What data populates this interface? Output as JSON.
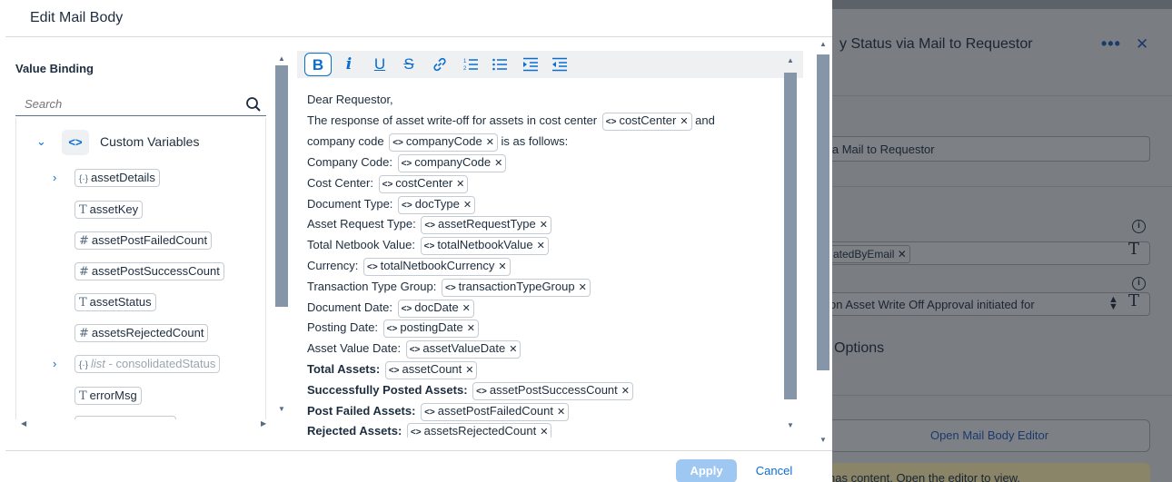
{
  "dialog": {
    "title": "Edit Mail Body",
    "apply_label": "Apply",
    "cancel_label": "Cancel"
  },
  "value_binding": {
    "title": "Value Binding",
    "search_placeholder": "Search",
    "root": "Custom Variables",
    "items": [
      {
        "name": "assetDetails",
        "type": "object"
      },
      {
        "name": "assetKey",
        "type": "T"
      },
      {
        "name": "assetPostFailedCount",
        "type": "#"
      },
      {
        "name": "assetPostSuccessCount",
        "type": "#"
      },
      {
        "name": "assetStatus",
        "type": "T"
      },
      {
        "name": "assetsRejectedCount",
        "type": "#"
      },
      {
        "name": "consolidatedStatus",
        "type": "list",
        "prefix": "list",
        "sep": " - "
      },
      {
        "name": "errorMsg",
        "type": "T"
      }
    ]
  },
  "toolbar": {
    "bold": "B",
    "italic": "i",
    "underline": "U",
    "strike": "S",
    "link": "link-icon",
    "ordered_list": "ordered-list-icon",
    "bullet_list": "bullet-list-icon",
    "indent": "indent-icon",
    "outdent": "outdent-icon"
  },
  "editor": {
    "line0": "Dear Requestor,",
    "line1_text": "The response of asset write-off for assets in cost center",
    "line1_token": "costCenter",
    "line1_tail": "and",
    "line2_text": "company code",
    "line2_token": "companyCode",
    "line2_tail": "is as follows:",
    "fields": [
      {
        "label": "Company Code:",
        "token": "companyCode",
        "bold": false
      },
      {
        "label": "Cost Center:",
        "token": "costCenter",
        "bold": false
      },
      {
        "label": "Document Type:",
        "token": "docType",
        "bold": false
      },
      {
        "label": "Asset Request Type:",
        "token": "assetRequestType",
        "bold": false
      },
      {
        "label": "Total Netbook Value:",
        "token": "totalNetbookValue",
        "bold": false
      },
      {
        "label": "Currency:",
        "token": "totalNetbookCurrency",
        "bold": false
      },
      {
        "label": "Transaction Type Group:",
        "token": "transactionTypeGroup",
        "bold": false
      },
      {
        "label": "Document Date:",
        "token": "docDate",
        "bold": false
      },
      {
        "label": "Posting Date:",
        "token": "postingDate",
        "bold": false
      },
      {
        "label": "Asset Value Date:",
        "token": "assetValueDate",
        "bold": false
      },
      {
        "label": "Total Assets:",
        "token": "assetCount",
        "bold": true
      },
      {
        "label": "Successfully Posted Assets:",
        "token": "assetPostSuccessCount",
        "bold": true
      },
      {
        "label": "Post Failed Assets:",
        "token": "assetPostFailedCount",
        "bold": true
      },
      {
        "label": "Rejected Assets:",
        "token": "assetsRejectedCount",
        "bold": true
      }
    ],
    "token_icon": "<>",
    "token_remove": "✕"
  },
  "background": {
    "title": "y Status via Mail to Requestor",
    "more": "•••",
    "close": "✕",
    "subject_value": "ia Mail to Requestor",
    "token": "atedByEmail",
    "text_value": "on Asset Write Off Approval initiated for",
    "options_label": "Options",
    "editor_button": "Open Mail Body Editor",
    "strip_text": "has content. Open the editor to view."
  }
}
